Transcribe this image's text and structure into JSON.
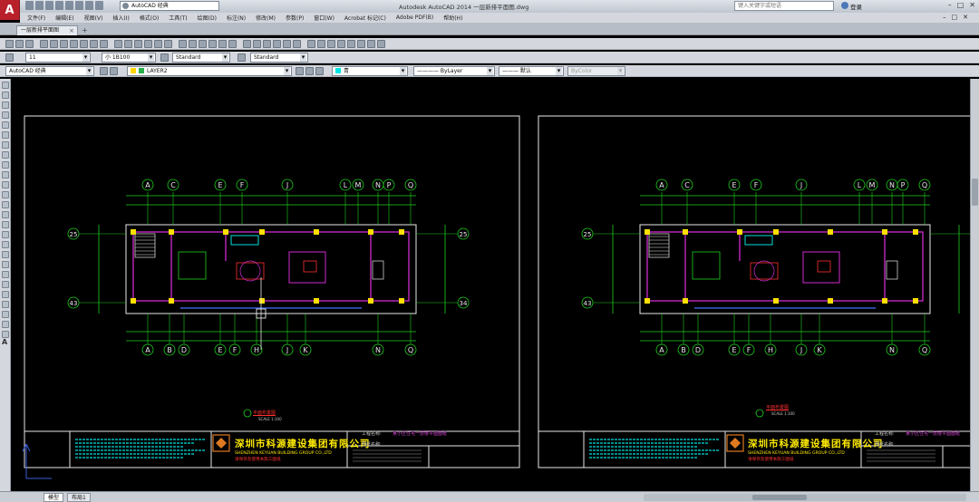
{
  "window": {
    "title": "Autodesk AutoCAD 2014    一层新排平面图.dwg",
    "workspace": "AutoCAD 经典",
    "search_placeholder": "键入关键字或短语",
    "login": "登录",
    "controls": [
      "–",
      "□",
      "✕"
    ]
  },
  "menu": [
    "文件(F)",
    "编辑(E)",
    "视图(V)",
    "插入(I)",
    "格式(O)",
    "工具(T)",
    "绘图(D)",
    "标注(N)",
    "修改(M)",
    "参数(P)",
    "窗口(W)",
    "Acrobat 标记(C)",
    "Adobe PDF(B)",
    "帮助(H)"
  ],
  "document_tab": "一层新排平面图",
  "toolbar2": {
    "text_height": "11",
    "annotation_scale": "小 1B100",
    "text_style": "Standard",
    "table_style": "Standard"
  },
  "toolbar3": {
    "workspace": "AutoCAD 经典",
    "layer": "LAYER2",
    "color": "青",
    "linetype": "ByLayer",
    "lineweight": "默认",
    "plotstyle": "ByColor"
  },
  "drawings": [
    {
      "top_grid": [
        "A",
        "C",
        "E",
        "F",
        "J",
        "L",
        "M",
        "N",
        "P",
        "Q"
      ],
      "bottom_grid": [
        "A",
        "B",
        "D",
        "E",
        "F",
        "H",
        "J",
        "K",
        "N",
        "Q"
      ],
      "left_rows": [
        "25",
        "43"
      ],
      "right_rows": [
        "25",
        "34"
      ],
      "title": "平面布置图",
      "scale": "SCALE 1:100"
    },
    {
      "top_grid": [
        "A",
        "C",
        "E",
        "F",
        "J",
        "L",
        "M",
        "N",
        "P",
        "Q"
      ],
      "bottom_grid": [
        "A",
        "B",
        "D",
        "E",
        "F",
        "H",
        "J",
        "K",
        "N",
        "Q"
      ],
      "left_rows": [
        "25",
        "43"
      ],
      "right_rows": [
        "25"
      ],
      "title": "平面布置图",
      "scale": "SCALE 1:100"
    }
  ],
  "title_block": {
    "company": "深圳市科源建设集团有限公司",
    "company_en": "SHENZHEN  KEYUAN  BUILDING  GROUP CO.,LTD",
    "note": "请保存及使用本施工图纸",
    "label_project": "工程名称:",
    "label_drawing": "图纸名称:",
    "project": "某小区住宅一层楼平面图纸"
  },
  "layout_tabs": [
    "模型",
    "布局1"
  ]
}
